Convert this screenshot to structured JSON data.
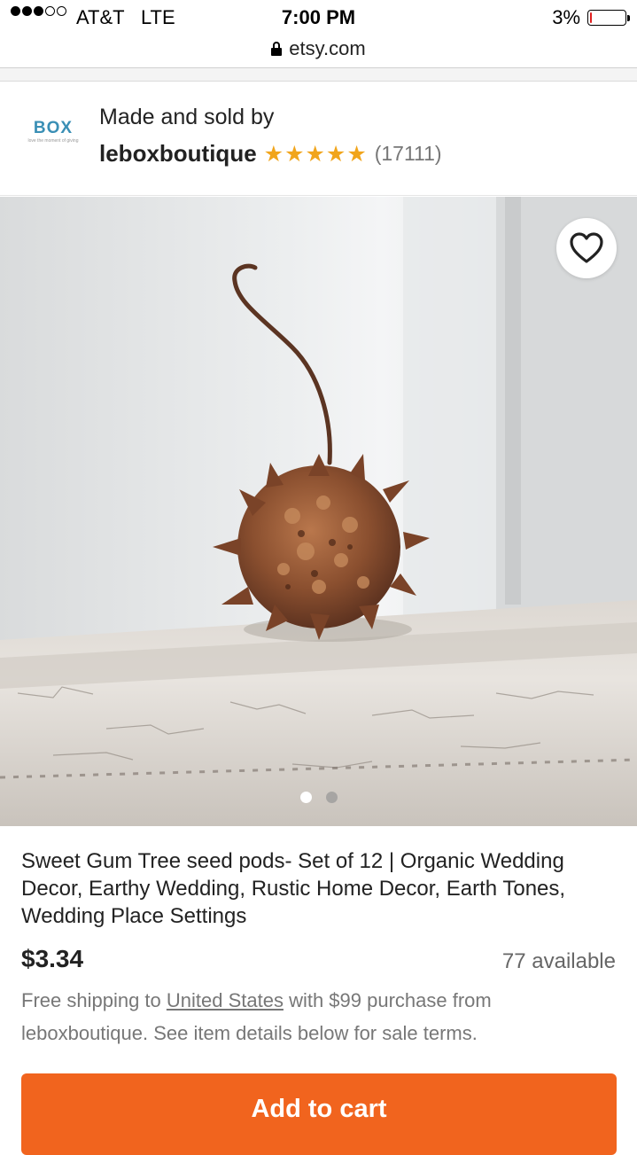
{
  "status_bar": {
    "carrier": "AT&T",
    "network": "LTE",
    "time": "7:00 PM",
    "battery": "3%",
    "battery_level": 0.03,
    "signal_bars": 3,
    "signal_total": 5
  },
  "browser": {
    "url": "etsy.com"
  },
  "shop": {
    "logo_text": "BOX",
    "logo_tagline": "love the moment of giving",
    "made_by_label": "Made and sold by",
    "name": "leboxboutique",
    "stars": "★★★★★",
    "rating": 5,
    "review_count": "(17111)"
  },
  "gallery": {
    "image_description_icon": "sweet-gum-seed-pod-photo",
    "favorite_icon": "heart-outline-icon",
    "total_images": 2,
    "active_index": 0
  },
  "listing": {
    "title": "Sweet Gum Tree seed pods- Set of 12 | Organic Wedding Decor, Earthy Wedding, Rustic Home Decor, Earth Tones, Wedding Place Settings",
    "price": "$3.34",
    "availability": "77 available",
    "shipping_prefix": "Free shipping to ",
    "shipping_country": "United States",
    "shipping_suffix": " with $99 purchase from leboxboutique. See item details below for sale terms.",
    "add_to_cart_label": "Add to cart"
  },
  "colors": {
    "cart_button": "#f1641e",
    "stars": "#f1a51c",
    "battery_low": "#e02020"
  }
}
